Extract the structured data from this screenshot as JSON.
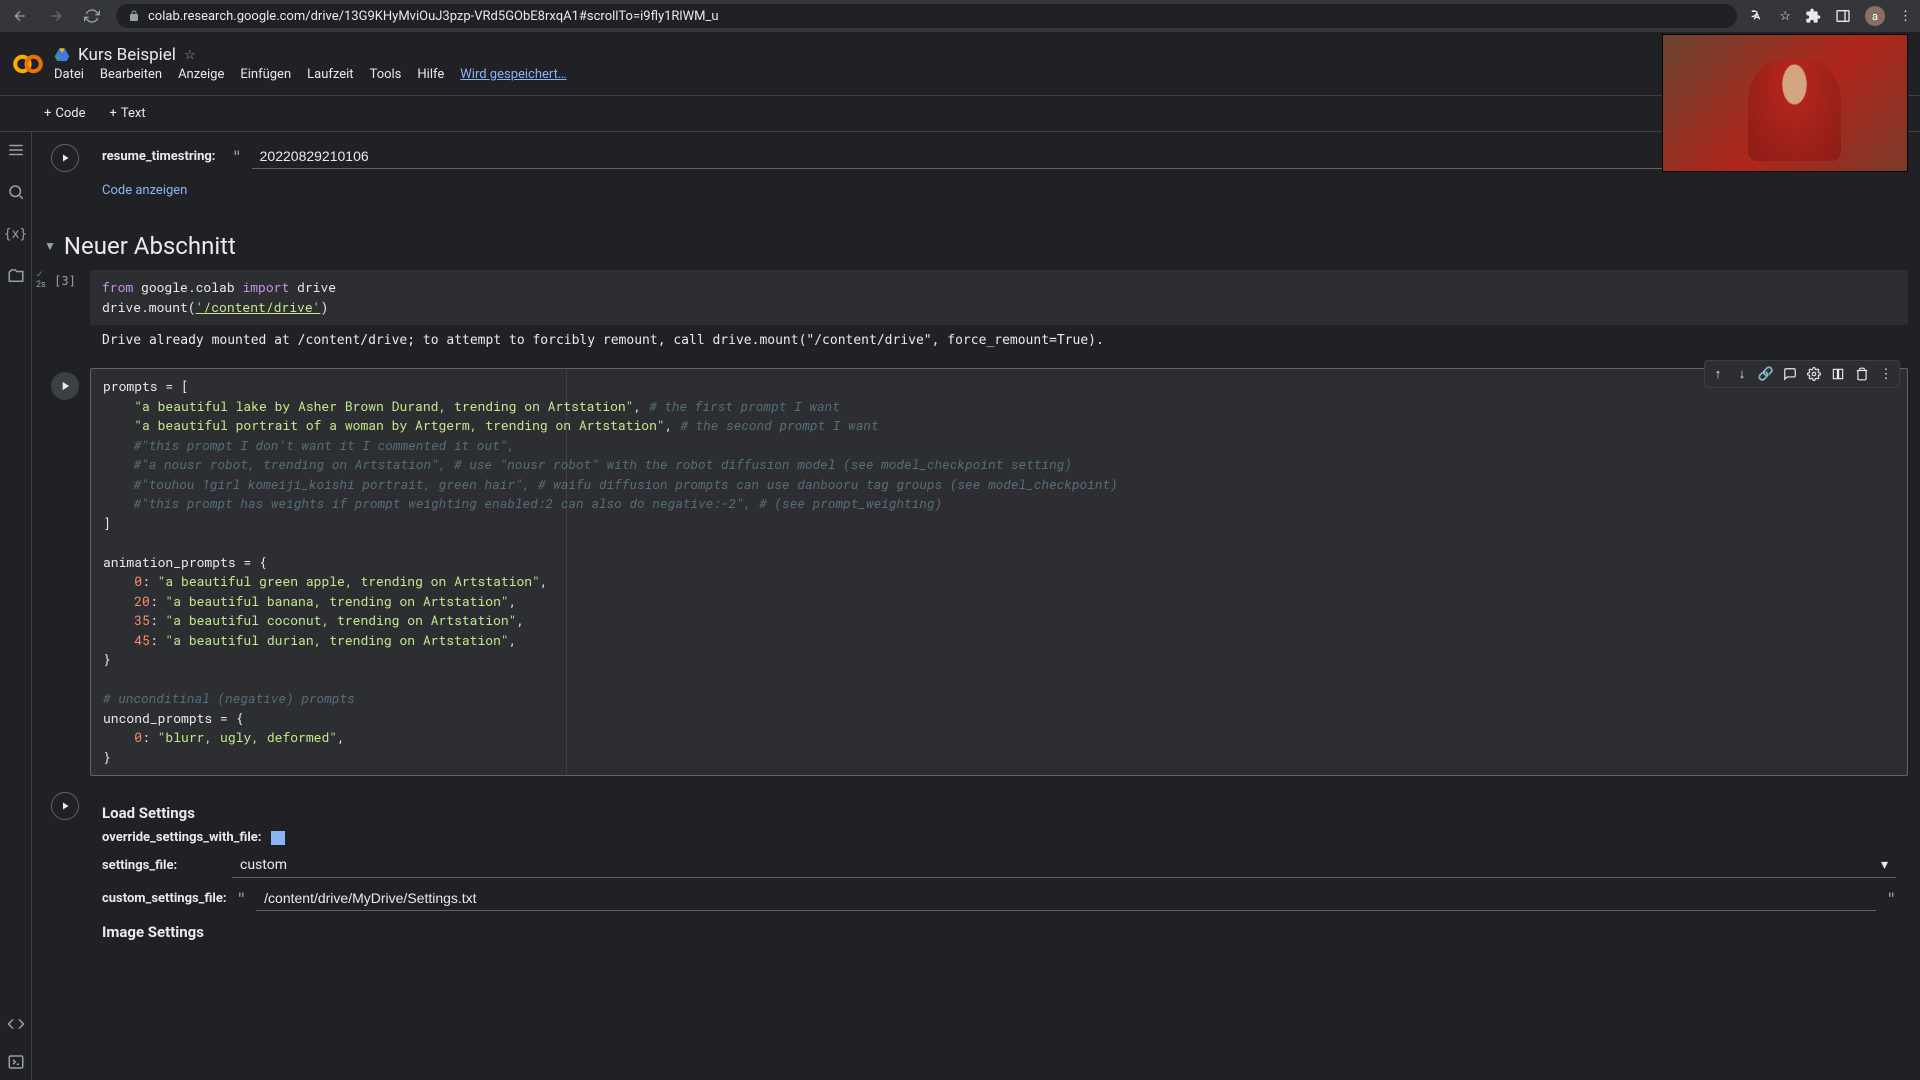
{
  "browser": {
    "url": "colab.research.google.com/drive/13G9KHyMviOuJ3pzp-VRd5GObE8rxqA1#scrollTo=i9fly1RlWM_u",
    "avatar_letter": "a"
  },
  "header": {
    "title": "Kurs Beispiel",
    "menu": [
      "Datei",
      "Bearbeiten",
      "Anzeige",
      "Einfügen",
      "Laufzeit",
      "Tools",
      "Hilfe"
    ],
    "status": "Wird gespeichert…"
  },
  "toolbar": {
    "code": "Code",
    "text": "Text"
  },
  "cells": {
    "resume": {
      "label": "resume_timestring:",
      "value": "20220829210106",
      "show_code": "Code anzeigen"
    },
    "section_title": "Neuer Abschnitt",
    "drive_cell": {
      "exec_count": "[3]",
      "exec_time": "2s",
      "line1_kw1": "from",
      "line1_mod": " google.colab ",
      "line1_kw2": "import",
      "line1_name": " drive",
      "line2_pre": "drive.mount(",
      "line2_str": "'/content/drive'",
      "line2_post": ")",
      "output": "Drive already mounted at /content/drive; to attempt to forcibly remount, call drive.mount(\"/content/drive\", force_remount=True)."
    },
    "prompts_cell": {
      "l1": "prompts = [",
      "l2a": "    \"a beautiful lake by Asher Brown Durand, trending on Artstation\"",
      "l2b": ", ",
      "l2c": "# the first prompt I want",
      "l3a": "    \"a beautiful portrait of a woman by Artgerm, trending on Artstation\"",
      "l3b": ", ",
      "l3c": "# the second prompt I want",
      "l4": "    #\"this prompt I don't want it I commented it out\",",
      "l5": "    #\"a nousr robot, trending on Artstation\", # use \"nousr robot\" with the robot diffusion model (see model_checkpoint setting)",
      "l6": "    #\"touhou 1girl komeiji_koishi portrait, green hair\", # waifu diffusion prompts can use danbooru tag groups (see model_checkpoint)",
      "l7": "    #\"this prompt has weights if prompt weighting enabled:2 can also do negative:-2\", # (see prompt_weighting)",
      "l8": "]",
      "l9": "",
      "l10": "animation_prompts = {",
      "l11a": "    0",
      "l11b": ": ",
      "l11c": "\"a beautiful green apple, trending on Artstation\"",
      "l11d": ",",
      "l12a": "    20",
      "l12b": ": ",
      "l12c": "\"a beautiful banana, trending on Artstation\"",
      "l12d": ",",
      "l13a": "    35",
      "l13b": ": ",
      "l13c": "\"a beautiful coconut, trending on Artstation\"",
      "l13d": ",",
      "l14a": "    45",
      "l14b": ": ",
      "l14c": "\"a beautiful durian, trending on Artstation\"",
      "l14d": ",",
      "l15": "}",
      "l16": "",
      "l17": "# unconditinal (negative) prompts",
      "l18": "uncond_prompts = {",
      "l19a": "    0",
      "l19b": ": ",
      "l19c": "\"blurr, ugly, deformed\"",
      "l19d": ",",
      "l20": "}"
    },
    "load_settings": {
      "title": "Load Settings",
      "override_label": "override_settings_with_file:",
      "settings_file_label": "settings_file:",
      "settings_file_value": "custom",
      "custom_file_label": "custom_settings_file:",
      "custom_file_value": "/content/drive/MyDrive/Settings.txt"
    },
    "image_settings_title": "Image Settings"
  }
}
